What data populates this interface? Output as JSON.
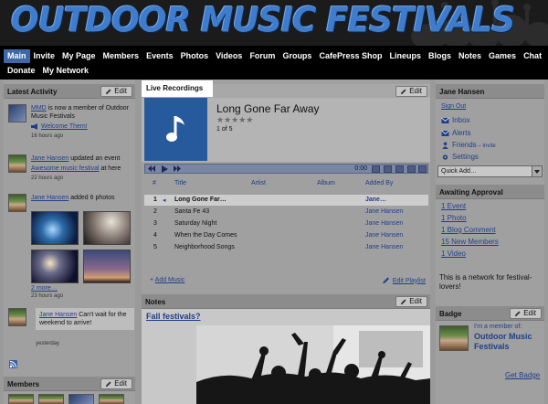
{
  "site": {
    "title": "OUTDOOR MUSIC FESTIVALS"
  },
  "nav": {
    "row1": [
      "Main",
      "Invite",
      "My Page",
      "Members",
      "Events",
      "Photos",
      "Videos",
      "Forum",
      "Groups",
      "CafePress Shop",
      "Lineups",
      "Blogs",
      "Notes",
      "Games",
      "Chat"
    ],
    "row2": [
      "Donate",
      "My Network"
    ],
    "active": "Main"
  },
  "latest_activity": {
    "title": "Latest Activity",
    "edit_label": "Edit",
    "items": [
      {
        "actor": "MMD",
        "text": " is now a member of Outdoor Music Festivals",
        "link": "Welcome Them!",
        "time": "16 hours ago"
      },
      {
        "actor": "Jane Hansen",
        "text": " updated an event",
        "link": "Awesome music festival",
        "after": " at here",
        "time": "22 hours ago"
      },
      {
        "actor": "Jane Hansen",
        "text": " added 6 photos",
        "more": "2 more…",
        "time": "23 hours ago"
      },
      {
        "actor": "Jane Hansen",
        "text": " Can't wait for the weekend to arrive!",
        "time": "yesterday"
      }
    ]
  },
  "members": {
    "title": "Members",
    "edit_label": "Edit"
  },
  "player": {
    "tab_label": "Live Recordings",
    "edit_label": "Edit",
    "song_title": "Long Gone Far Away",
    "rating": "★★★★★",
    "track_position": "1 of 5",
    "time": "0:00",
    "columns": [
      "#",
      "Title",
      "Artist",
      "Album",
      "Added By"
    ],
    "tracks": [
      {
        "num": "1",
        "title": "Long Gone Far…",
        "artist": "",
        "album": "",
        "added_by": "Jane…",
        "selected": true
      },
      {
        "num": "2",
        "title": "Santa Fe 43",
        "artist": "",
        "album": "",
        "added_by": "Jane Hansen",
        "selected": false
      },
      {
        "num": "3",
        "title": "Saturday Night",
        "artist": "",
        "album": "",
        "added_by": "Jane Hansen",
        "selected": false
      },
      {
        "num": "4",
        "title": "When the Day Comes",
        "artist": "",
        "album": "",
        "added_by": "Jane Hansen",
        "selected": false
      },
      {
        "num": "5",
        "title": "Neighborhood Songs",
        "artist": "",
        "album": "",
        "added_by": "Jane Hansen",
        "selected": false
      }
    ],
    "add_music": "Add Music",
    "edit_playlist": "Edit Playlist"
  },
  "notes": {
    "title": "Notes",
    "edit_label": "Edit",
    "link": "Fall festivals?"
  },
  "account": {
    "title": "Jane Hansen",
    "sign_out": "Sign Out",
    "inbox": "Inbox",
    "alerts": "Alerts",
    "friends": "Friends",
    "friends_invite": " – Invite",
    "settings": "Settings",
    "quick_add": "Quick Add…"
  },
  "approval": {
    "title": "Awaiting Approval",
    "items": [
      "1 Event",
      "1 Photo",
      "1 Blog Comment",
      "15 New Members",
      "1 Video"
    ]
  },
  "network_description": "This is a network for festival-lovers!",
  "badge": {
    "title": "Badge",
    "edit_label": "Edit",
    "member_of": "I'm a member of:",
    "network_name": "Outdoor Music Festivals",
    "get_badge": "Get Badge"
  },
  "colors": {
    "accent": "#3f68a8",
    "link": "#1f3f8a",
    "album": "#275a9c",
    "page": "#a0a0a0"
  }
}
